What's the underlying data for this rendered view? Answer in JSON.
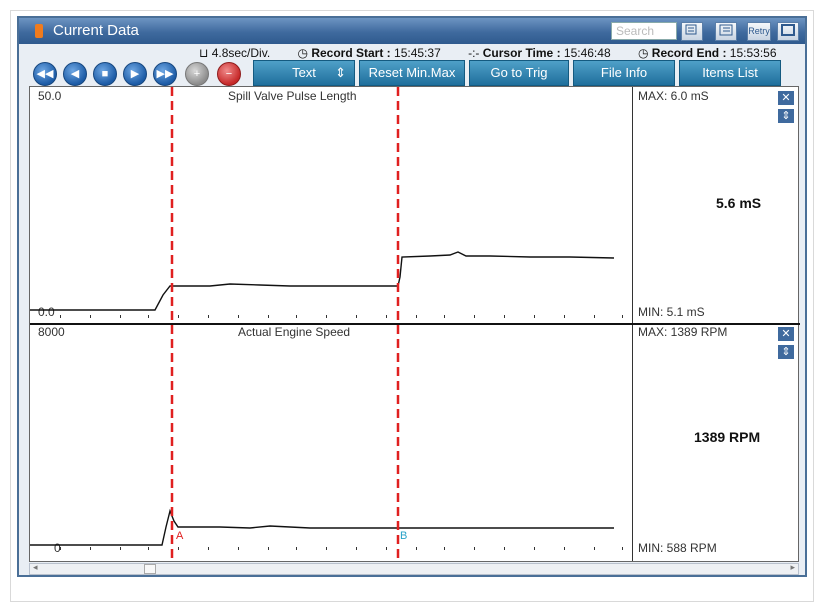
{
  "window": {
    "title": "Current Data",
    "search_placeholder": "Search",
    "retry_label": "Retry"
  },
  "info": {
    "time_div": "4.8sec/Div.",
    "record_start_label": "Record Start :",
    "record_start": "15:45:37",
    "cursor_time_label": "Cursor Time :",
    "cursor_time": "15:46:48",
    "record_end_label": "Record End :",
    "record_end": "15:53:56"
  },
  "actions": {
    "text": "Text",
    "reset": "Reset Min.Max",
    "go_to_trig": "Go to Trig",
    "file_info": "File Info",
    "items_list": "Items List"
  },
  "panels": [
    {
      "name": "Spill Valve Pulse Length",
      "ymax_label": "50.0",
      "ymin_label": "0.0",
      "max_label": "MAX:  6.0 mS",
      "min_label": "MIN:  5.1 mS",
      "value": "5.6 mS"
    },
    {
      "name": "Actual Engine Speed",
      "ymax_label": "8000",
      "ymin_label": "0",
      "max_label": "MAX:  1389 RPM",
      "min_label": "MIN:   588 RPM",
      "value": "1389 RPM"
    }
  ],
  "cursors": {
    "a_label": "A",
    "b_label": "B"
  }
}
